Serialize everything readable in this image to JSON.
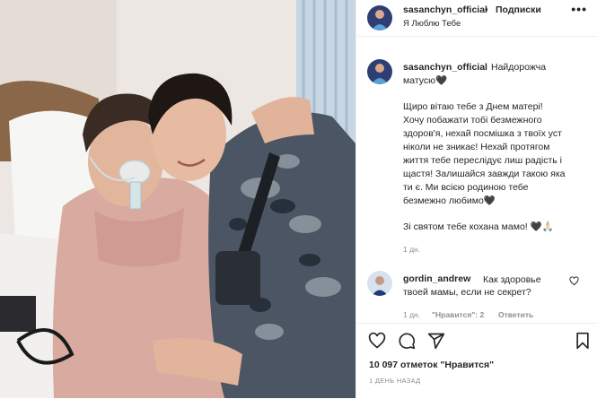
{
  "header": {
    "username": "sasanchyn_official",
    "separator": "•",
    "follow_label": "Подписки",
    "audio": "Я Люблю Тебе",
    "more": "•••"
  },
  "caption": {
    "username": "sasanchyn_official",
    "first_line": "Найдорожча",
    "second_line": "матусю🖤",
    "lines": [
      "Щиро вітаю тебе з Днем матері!",
      "Хочу побажати тобі безмежного",
      "здоров'я, нехай посмішка з твоїх уст",
      "ніколи не зникає! Нехай протягом",
      "життя тебе переслідує лиш радість і",
      "щастя! Залишайся завжди такою яка",
      "ти є. Ми всією родиною тебе",
      "безмежно любимо🖤"
    ],
    "closing": "Зі святом тебе кохана мамо! 🖤🙏🏻",
    "time": "1 дн."
  },
  "comment": {
    "username": "gordin_andrew",
    "text_line1": "Как здоровье",
    "text_line2": "твоей мамы, если не секрет?",
    "time": "1 дн.",
    "likes": "\"Нравится\": 2",
    "reply": "Ответить"
  },
  "likes_text": "10 097 отметок \"Нравится\"",
  "date": "1 ДЕНЬ НАЗАД",
  "icons": [
    "heart-icon",
    "comment-icon",
    "share-icon",
    "bookmark-icon",
    "more-icon"
  ],
  "colors": {
    "text": "#262626",
    "muted": "#8e8e8e",
    "border": "#efefef"
  }
}
